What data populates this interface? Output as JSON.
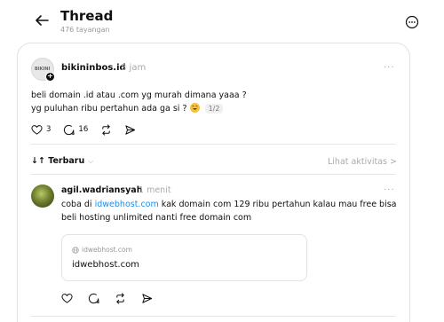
{
  "header": {
    "title": "Thread",
    "views": "476 tayangan"
  },
  "post": {
    "username": "bikininbos.id",
    "time": "3 jam",
    "avatar_logo_text": "BIKINI",
    "text_line1": "beli domain .id atau .com yg murah dimana yaaa ?",
    "text_line2": "yg puluhan ribu pertahun ada ga si ?",
    "page_counter": "1/2",
    "likes": "3",
    "comments": "16"
  },
  "sort": {
    "label": "Terbaru",
    "activity_link": "Lihat aktivitas >"
  },
  "reply": {
    "username": "agil.wadriansyah",
    "time": "1 menit",
    "text_prefix": "coba di ",
    "link_text": "idwebhost.com",
    "text_suffix": " kak domain com 129 ribu pertahun kalau mau free bisa",
    "text_line2": "beli hosting unlimited nanti free domain com",
    "preview_domain": "idwebhost.com",
    "preview_title": "idwebhost.com"
  },
  "colors": {
    "link": "#1b8de8",
    "muted": "#aaaaaa",
    "text": "#101010"
  }
}
